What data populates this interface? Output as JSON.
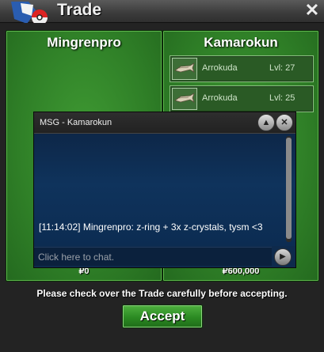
{
  "window": {
    "title": "Trade"
  },
  "left_panel": {
    "name": "Mingrenpro",
    "money": "₽0"
  },
  "right_panel": {
    "name": "Kamarokun",
    "money": "₽600,000",
    "items": [
      {
        "name": "Arrokuda",
        "level": "Lvl: 27",
        "icon": "fish-icon"
      },
      {
        "name": "Arrokuda",
        "level": "Lvl: 25",
        "icon": "fish-icon"
      }
    ]
  },
  "chat": {
    "title": "MSG - Kamarokun",
    "message": "[11:14:02] Mingrenpro: z-ring + 3x z-crystals, tysm <3",
    "input_placeholder": "Click here to chat."
  },
  "notice": "Please check over the Trade carefully before accepting.",
  "accept_label": "Accept",
  "colors": {
    "panel_green": "#2f7f27",
    "chat_blue": "#0e2a4c",
    "accept_green": "#2b8a22"
  }
}
